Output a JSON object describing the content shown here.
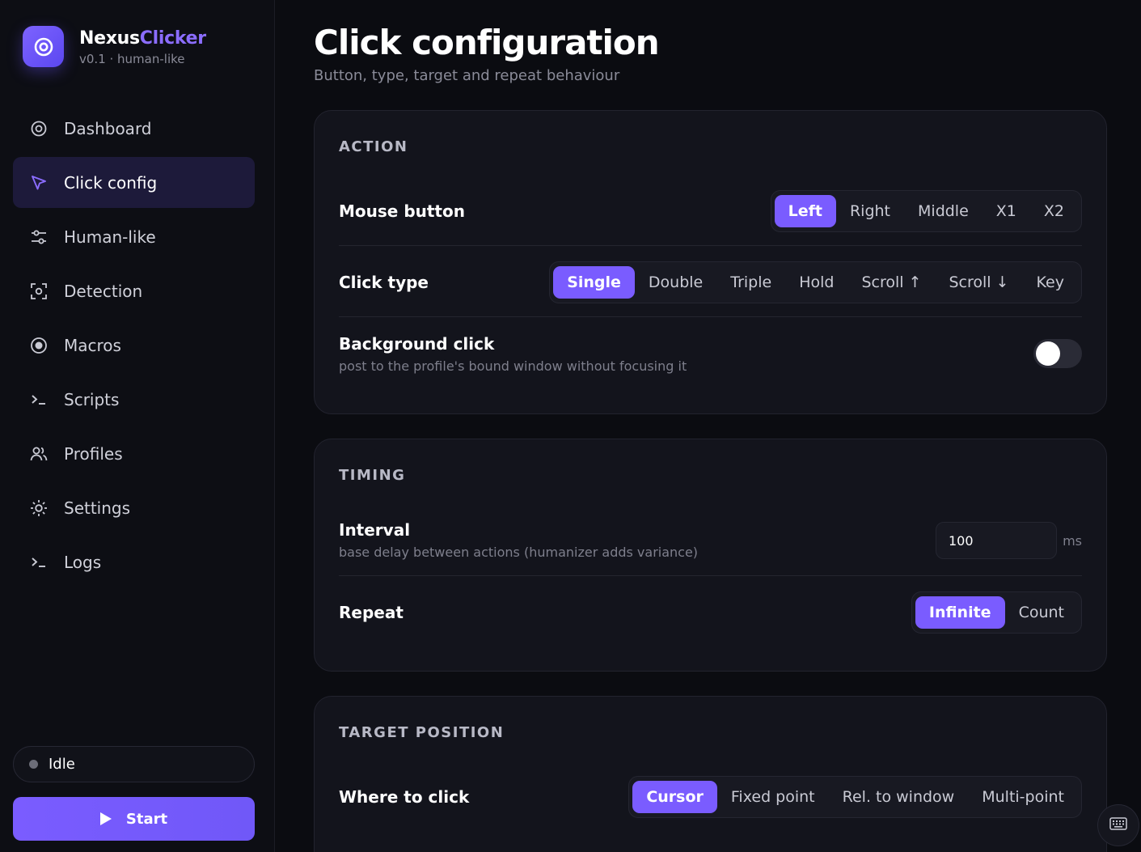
{
  "brand": {
    "name_part1": "Nexus",
    "name_part2": "Clicker",
    "subtitle": "v0.1 · human-like",
    "logo_icon": "target-icon"
  },
  "nav": [
    {
      "label": "Dashboard",
      "icon": "dashboard-icon",
      "active": false
    },
    {
      "label": "Click config",
      "icon": "cursor-icon",
      "active": true
    },
    {
      "label": "Human-like",
      "icon": "sliders-icon",
      "active": false
    },
    {
      "label": "Detection",
      "icon": "scan-icon",
      "active": false
    },
    {
      "label": "Macros",
      "icon": "record-icon",
      "active": false
    },
    {
      "label": "Scripts",
      "icon": "terminal-icon",
      "active": false
    },
    {
      "label": "Profiles",
      "icon": "users-icon",
      "active": false
    },
    {
      "label": "Settings",
      "icon": "gear-icon",
      "active": false
    },
    {
      "label": "Logs",
      "icon": "terminal-icon",
      "active": false
    }
  ],
  "status": {
    "label": "Idle"
  },
  "start_button": {
    "label": "Start"
  },
  "page": {
    "title": "Click configuration",
    "subtitle": "Button, type, target and repeat behaviour"
  },
  "action": {
    "title": "ACTION",
    "mouse_button": {
      "label": "Mouse button",
      "options": [
        "Left",
        "Right",
        "Middle",
        "X1",
        "X2"
      ],
      "selected": "Left"
    },
    "click_type": {
      "label": "Click type",
      "options": [
        "Single",
        "Double",
        "Triple",
        "Hold",
        "Scroll ↑",
        "Scroll ↓",
        "Key"
      ],
      "selected": "Single"
    },
    "background_click": {
      "label": "Background click",
      "description": "post to the profile's bound window without focusing it",
      "enabled": false
    }
  },
  "timing": {
    "title": "TIMING",
    "interval": {
      "label": "Interval",
      "description": "base delay between actions (humanizer adds variance)",
      "value": "100",
      "unit": "ms"
    },
    "repeat": {
      "label": "Repeat",
      "options": [
        "Infinite",
        "Count"
      ],
      "selected": "Infinite"
    }
  },
  "target": {
    "title": "TARGET POSITION",
    "where": {
      "label": "Where to click",
      "options": [
        "Cursor",
        "Fixed point",
        "Rel. to window",
        "Multi-point"
      ],
      "selected": "Cursor"
    }
  },
  "colors": {
    "accent": "#7a5cff",
    "background": "#0b0c11",
    "card": "#13141c"
  }
}
